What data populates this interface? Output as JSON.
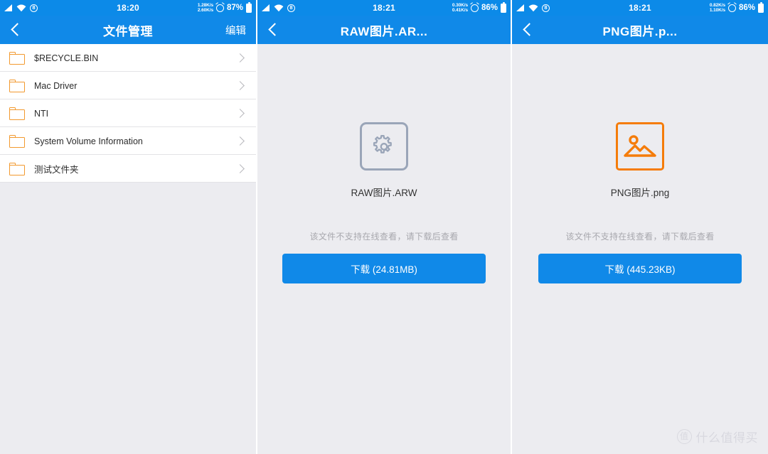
{
  "panels": [
    {
      "status": {
        "signal_icon": "signal-icon",
        "wifi_icon": "wifi-icon",
        "sim_icon": "sim-badge-icon",
        "sim_label": "8",
        "time": "18:20",
        "net_down": "1.28K/s",
        "net_up": "2.60K/s",
        "alarm_icon": "alarm-icon",
        "battery": "87%",
        "battery_icon": "battery-icon"
      },
      "nav": {
        "back_icon": "chevron-left-icon",
        "title": "文件管理",
        "action": "编辑"
      },
      "files": [
        {
          "name": "$RECYCLE.BIN",
          "icon": "folder-icon",
          "chevron": "chevron-right-icon"
        },
        {
          "name": "Mac Driver",
          "icon": "folder-icon",
          "chevron": "chevron-right-icon"
        },
        {
          "name": "NTI",
          "icon": "folder-icon",
          "chevron": "chevron-right-icon"
        },
        {
          "name": "System Volume Information",
          "icon": "folder-icon",
          "chevron": "chevron-right-icon"
        },
        {
          "name": "测试文件夹",
          "icon": "folder-icon",
          "chevron": "chevron-right-icon"
        }
      ]
    },
    {
      "status": {
        "time": "18:21",
        "net_down": "0.30K/s",
        "net_up": "0.41K/s",
        "battery": "86%"
      },
      "nav": {
        "back_icon": "chevron-left-icon",
        "title": "RAW图片.AR..."
      },
      "preview": {
        "icon": "gear-file-icon",
        "filename": "RAW图片.ARW",
        "hint": "该文件不支持在线查看，请下载后查看",
        "download_label": "下载 (24.81MB)"
      }
    },
    {
      "status": {
        "time": "18:21",
        "net_down": "0.82K/s",
        "net_up": "1.10K/s",
        "battery": "86%"
      },
      "nav": {
        "back_icon": "chevron-left-icon",
        "title": "PNG图片.p..."
      },
      "preview": {
        "icon": "image-file-icon",
        "filename": "PNG图片.png",
        "hint": "该文件不支持在线查看，请下载后查看",
        "download_label": "下载 (445.23KB)"
      }
    }
  ],
  "watermark": {
    "badge": "值",
    "text": "什么值得买"
  },
  "colors": {
    "status_blue": "#0c8ae8",
    "nav_blue": "#1089e8",
    "button_blue": "#1089e8",
    "folder_orange": "#f2992e",
    "image_orange": "#f57c0a",
    "gear_gray": "#9aa5b8",
    "page_bg": "#ececf0"
  }
}
